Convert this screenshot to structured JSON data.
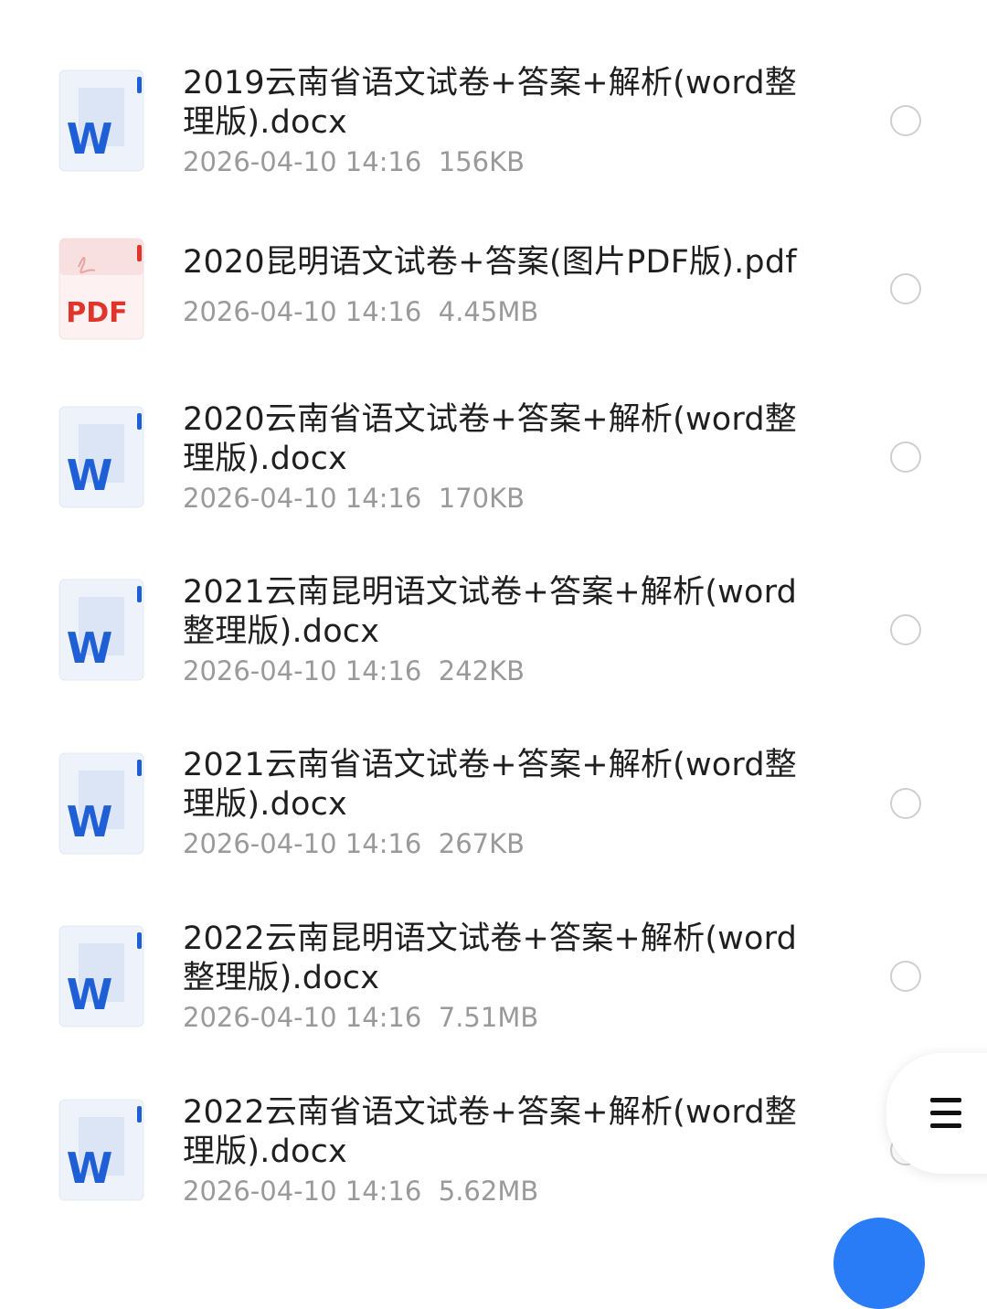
{
  "files": [
    {
      "type": "word",
      "icon": "word-doc-icon",
      "name": "2019云南省语文试卷+答案+解析(word整理版).docx",
      "date": "2026-04-10 14:16",
      "size": "156KB"
    },
    {
      "type": "pdf",
      "icon": "pdf-doc-icon",
      "name": "2020昆明语文试卷+答案(图片PDF版).pdf",
      "date": "2026-04-10 14:16",
      "size": "4.45MB"
    },
    {
      "type": "word",
      "icon": "word-doc-icon",
      "name": "2020云南省语文试卷+答案+解析(word整理版).docx",
      "date": "2026-04-10 14:16",
      "size": "170KB"
    },
    {
      "type": "word",
      "icon": "word-doc-icon",
      "name": "2021云南昆明语文试卷+答案+解析(word整理版).docx",
      "date": "2026-04-10 14:16",
      "size": "242KB"
    },
    {
      "type": "word",
      "icon": "word-doc-icon",
      "name": "2021云南省语文试卷+答案+解析(word整理版).docx",
      "date": "2026-04-10 14:16",
      "size": "267KB"
    },
    {
      "type": "word",
      "icon": "word-doc-icon",
      "name": "2022云南昆明语文试卷+答案+解析(word整理版).docx",
      "date": "2026-04-10 14:16",
      "size": "7.51MB"
    },
    {
      "type": "word",
      "icon": "word-doc-icon",
      "name": "2022云南省语文试卷+答案+解析(word整理版).docx",
      "date": "2026-04-10 14:16",
      "size": "5.62MB"
    }
  ],
  "icons": {
    "word_letter": "W",
    "pdf_letter": "PDF",
    "menu": "menu-icon"
  },
  "colors": {
    "word_blue": "#1f5fd6",
    "pdf_red": "#e0352b",
    "fab_blue": "#2a7cf6"
  }
}
